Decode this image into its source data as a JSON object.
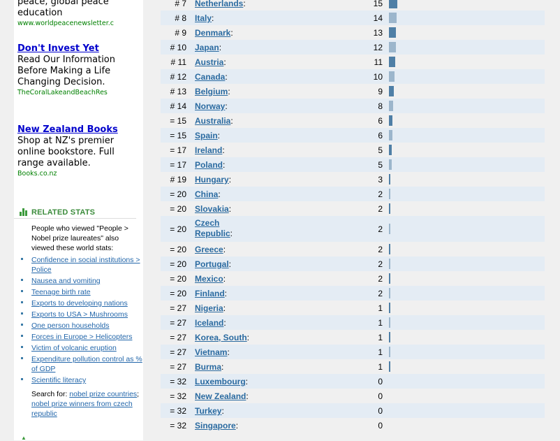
{
  "ads": [
    {
      "body_lines": [
        "peace, global peace",
        "education"
      ],
      "url": "www.worldpeacenewsletter.c"
    },
    {
      "title": "Don't Invest Yet",
      "body_lines": [
        "Read Our Information",
        "Before Making a Life",
        "Changing Decision."
      ],
      "url": "TheCoralLakeandBeachRes"
    },
    {
      "title": "New Zealand Books",
      "body_lines": [
        "Shop at NZ's premier",
        "online bookstore. Full",
        "range available."
      ],
      "url": "Books.co.nz"
    }
  ],
  "related": {
    "title": "RELATED STATS",
    "intro": "People who viewed \"People > Nobel prize laureates\" also viewed these world stats:",
    "links": [
      "Confidence in social institutions > Police",
      "Nausea and vomiting",
      "Teenage birth rate",
      "Exports to developing nations",
      "Exports to USA > Mushrooms",
      "One person households",
      "Forces in Europe > Helicopters",
      "Victim of volcanic eruption",
      "Expenditure pollution control as % of GDP",
      "Scientific literacy"
    ],
    "search_label": "Search for:",
    "search_links": [
      "nobel prize countries",
      "nobel prize winners from czech republic"
    ],
    "search_sep": "; "
  },
  "colors": {
    "bar_dark": "#4f7fa6",
    "bar_light": "#9cb6cc",
    "row_alt": "#e4ecf4",
    "link": "#2a6aa0"
  },
  "rows": [
    {
      "rank": "# 7",
      "country": "Netherlands",
      "value": "15",
      "level": 15,
      "alt": false
    },
    {
      "rank": "# 8",
      "country": "Italy",
      "value": "14",
      "level": 14,
      "alt": true
    },
    {
      "rank": "# 9",
      "country": "Denmark",
      "value": "13",
      "level": 13,
      "alt": false
    },
    {
      "rank": "# 10",
      "country": "Japan",
      "value": "12",
      "level": 12,
      "alt": true
    },
    {
      "rank": "# 11",
      "country": "Austria",
      "value": "11",
      "level": 11,
      "alt": false
    },
    {
      "rank": "# 12",
      "country": "Canada",
      "value": "10",
      "level": 10,
      "alt": true
    },
    {
      "rank": "# 13",
      "country": "Belgium",
      "value": "9",
      "level": 9,
      "alt": false
    },
    {
      "rank": "# 14",
      "country": "Norway",
      "value": "8",
      "level": 8,
      "alt": true
    },
    {
      "rank": "= 15",
      "country": "Australia",
      "value": "6",
      "level": 6,
      "alt": false
    },
    {
      "rank": "= 15",
      "country": "Spain",
      "value": "6",
      "level": 6,
      "alt": true
    },
    {
      "rank": "= 17",
      "country": "Ireland",
      "value": "5",
      "level": 5,
      "alt": false
    },
    {
      "rank": "= 17",
      "country": "Poland",
      "value": "5",
      "level": 5,
      "alt": true
    },
    {
      "rank": "# 19",
      "country": "Hungary",
      "value": "3",
      "level": 3,
      "alt": false
    },
    {
      "rank": "= 20",
      "country": "China",
      "value": "2",
      "level": 2,
      "alt": true
    },
    {
      "rank": "= 20",
      "country": "Slovakia",
      "value": "2",
      "level": 2,
      "alt": false
    },
    {
      "rank": "= 20",
      "country": "Czech Republic",
      "value": "2",
      "level": 2,
      "alt": true,
      "tall": true
    },
    {
      "rank": "= 20",
      "country": "Greece",
      "value": "2",
      "level": 2,
      "alt": false
    },
    {
      "rank": "= 20",
      "country": "Portugal",
      "value": "2",
      "level": 2,
      "alt": true
    },
    {
      "rank": "= 20",
      "country": "Mexico",
      "value": "2",
      "level": 2,
      "alt": false
    },
    {
      "rank": "= 20",
      "country": "Finland",
      "value": "2",
      "level": 2,
      "alt": true
    },
    {
      "rank": "= 27",
      "country": "Nigeria",
      "value": "1",
      "level": 1,
      "alt": false
    },
    {
      "rank": "= 27",
      "country": "Iceland",
      "value": "1",
      "level": 1,
      "alt": true
    },
    {
      "rank": "= 27",
      "country": "Korea, South",
      "value": "1",
      "level": 1,
      "alt": false
    },
    {
      "rank": "= 27",
      "country": "Vietnam",
      "value": "1",
      "level": 1,
      "alt": true
    },
    {
      "rank": "= 27",
      "country": "Burma",
      "value": "1",
      "level": 1,
      "alt": false
    },
    {
      "rank": "= 32",
      "country": "Luxembourg",
      "value": "0",
      "level": 0,
      "alt": true
    },
    {
      "rank": "= 32",
      "country": "New Zealand",
      "value": "0",
      "level": 0,
      "alt": false
    },
    {
      "rank": "= 32",
      "country": "Turkey",
      "value": "0",
      "level": 0,
      "alt": true
    },
    {
      "rank": "= 32",
      "country": "Singapore",
      "value": "0",
      "level": 0,
      "alt": false
    }
  ]
}
